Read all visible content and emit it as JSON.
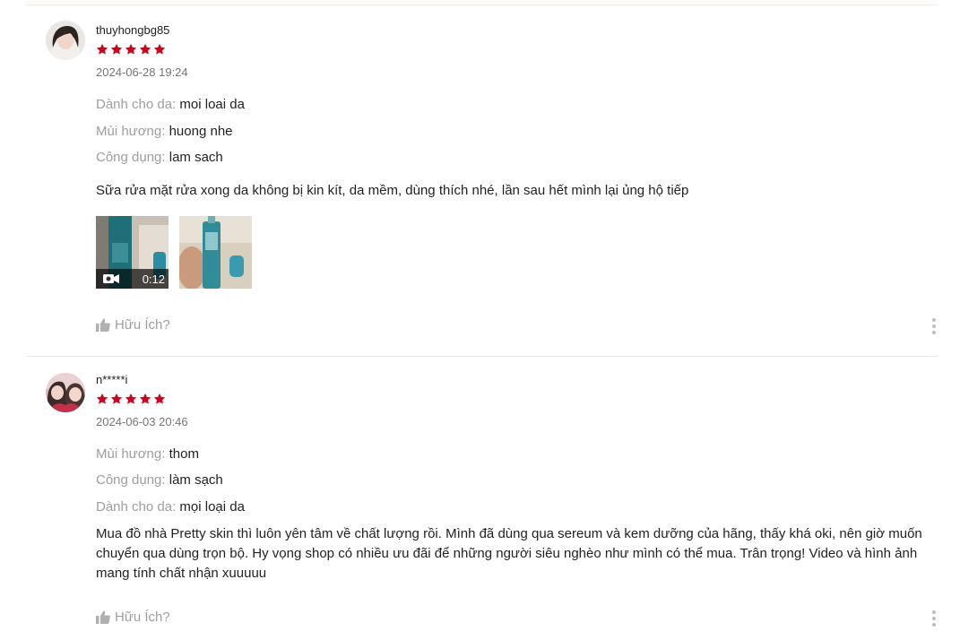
{
  "colors": {
    "star": "#d0011b",
    "muted": "#9e9e9e",
    "text": "#222222"
  },
  "reviews": [
    {
      "username": "thuyhongbg85",
      "rating": 5,
      "date": "2024-06-28 19:24",
      "attributes": [
        {
          "label": "Dành cho da:",
          "value": "moi loai da"
        },
        {
          "label": "Mùi hương:",
          "value": "huong nhe"
        },
        {
          "label": "Công dụng:",
          "value": "lam sach"
        }
      ],
      "text": "Sữa rửa mặt rửa xong da không bị kin kít, da mềm, dùng thích nhé, lần sau hết mình lại ủng hộ tiếp",
      "media": [
        {
          "type": "video",
          "duration": "0:12",
          "icon": "video-camera-icon"
        },
        {
          "type": "image"
        }
      ],
      "helpful_label": "Hữu Ích?"
    },
    {
      "username": "n*****i",
      "rating": 5,
      "date": "2024-06-03 20:46",
      "attributes": [
        {
          "label": "Mùi hương:",
          "value": "thom"
        },
        {
          "label": "Công dụng:",
          "value": "làm sạch"
        },
        {
          "label": "Dành cho da:",
          "value": "mọi loại da"
        }
      ],
      "text": "Mua đồ nhà Pretty skin thì luôn yên tâm về chất lượng rồi. Mình đã dùng qua sereum và kem dưỡng của hãng, thấy khá oki, nên giờ muốn chuyển qua dùng trọn bộ. Hy vọng shop có nhiều ưu đãi để những người siêu nghèo như mình có thể mua. Trân trọng! Video và hình ảnh mang tính chất nhận xuuuuu",
      "media": [],
      "helpful_label": "Hữu Ích?"
    }
  ]
}
